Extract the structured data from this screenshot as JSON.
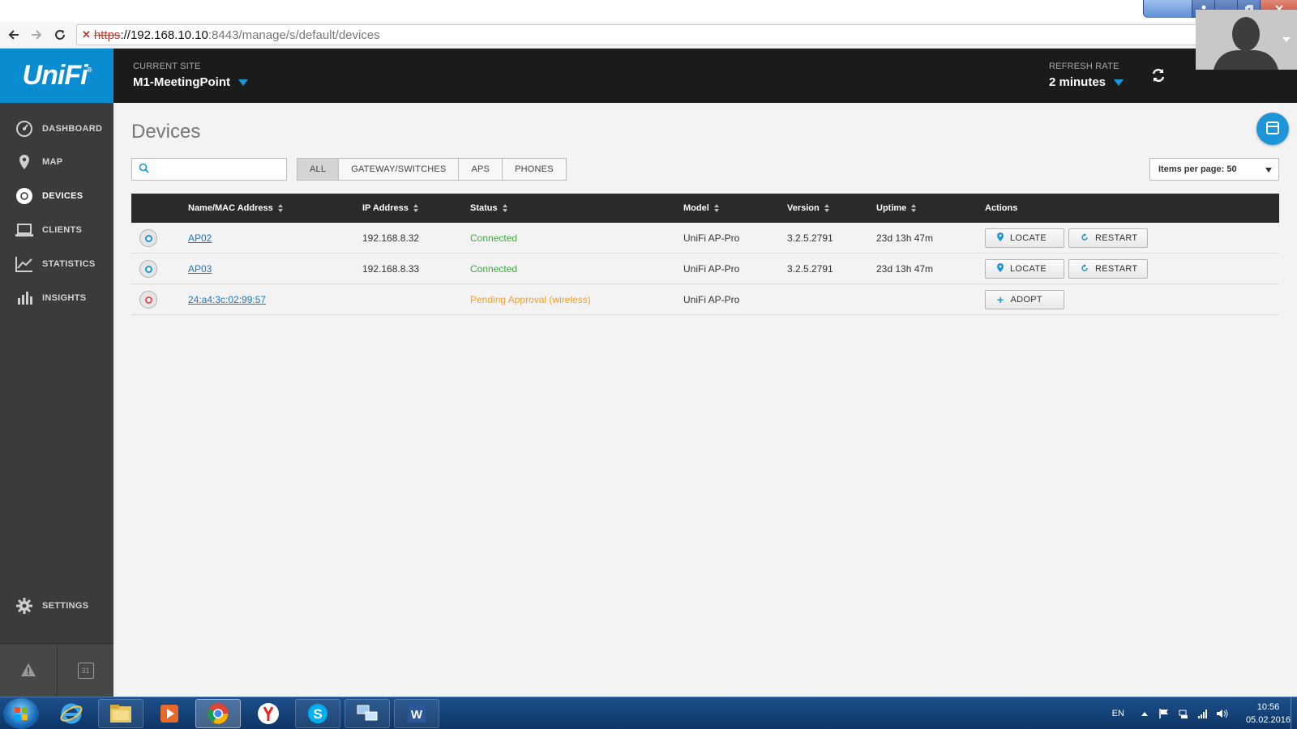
{
  "browser": {
    "url_scheme": "https",
    "url_host": "://192.168.10.10",
    "url_path": ":8443/manage/s/default/devices",
    "icons": [
      "back-icon",
      "forward-icon",
      "reload-icon",
      "zoom-icon",
      "translate-icon",
      "bookmark-star-icon",
      "menu-icon"
    ]
  },
  "header": {
    "logo_text": "UniFi",
    "logo_reg": "®",
    "site_label": "CURRENT SITE",
    "site_value": "M1-MeetingPoint",
    "refresh_label": "REFRESH RATE",
    "refresh_value": "2 minutes"
  },
  "sidebar": {
    "items": [
      {
        "label": "DASHBOARD",
        "icon": "dashboard-gauge-icon"
      },
      {
        "label": "MAP",
        "icon": "map-pin-icon"
      },
      {
        "label": "DEVICES",
        "icon": "devices-circle-icon"
      },
      {
        "label": "CLIENTS",
        "icon": "laptop-icon"
      },
      {
        "label": "STATISTICS",
        "icon": "line-chart-icon"
      },
      {
        "label": "INSIGHTS",
        "icon": "bar-chart-icon"
      }
    ],
    "settings_label": "SETTINGS",
    "alerts_icon": "warning-icon",
    "events_icon": "calendar-icon",
    "calendar_day": "31"
  },
  "main": {
    "title": "Devices",
    "search_placeholder": "",
    "filters": [
      "ALL",
      "GATEWAY/SWITCHES",
      "APS",
      "PHONES"
    ],
    "active_filter": "ALL",
    "items_per_page": "Items per page: 50"
  },
  "table": {
    "columns": {
      "name": "Name/MAC Address",
      "ip": "IP Address",
      "status": "Status",
      "model": "Model",
      "version": "Version",
      "uptime": "Uptime",
      "actions": "Actions"
    },
    "rows": [
      {
        "name": "AP02",
        "ip": "192.168.8.32",
        "status": "Connected",
        "model": "UniFi AP-Pro",
        "version": "3.2.5.2791",
        "uptime": "23d 13h 47m",
        "action1": "LOCATE",
        "action2": "RESTART"
      },
      {
        "name": "AP03",
        "ip": "192.168.8.33",
        "status": "Connected",
        "model": "UniFi AP-Pro",
        "version": "3.2.5.2791",
        "uptime": "23d 13h 47m",
        "action1": "LOCATE",
        "action2": "RESTART"
      },
      {
        "name": "24:a4:3c:02:99:57",
        "ip": "",
        "status": "Pending Approval (wireless)",
        "model": "UniFi AP-Pro",
        "version": "",
        "uptime": "",
        "action1": "ADOPT"
      }
    ]
  },
  "taskbar": {
    "apps": [
      "windows-start-icon",
      "internet-explorer-icon",
      "file-explorer-icon",
      "media-player-icon",
      "chrome-icon",
      "yandex-icon",
      "skype-icon",
      "network-app-icon",
      "word-icon"
    ],
    "lang": "EN",
    "time": "10:56",
    "date": "05.02.2016"
  },
  "colors": {
    "accent": "#1e95d8",
    "header_bg": "#1b1b1b",
    "sidebar_bg": "#3b3b3b",
    "connected": "#45a545",
    "pending": "#f0a030"
  }
}
